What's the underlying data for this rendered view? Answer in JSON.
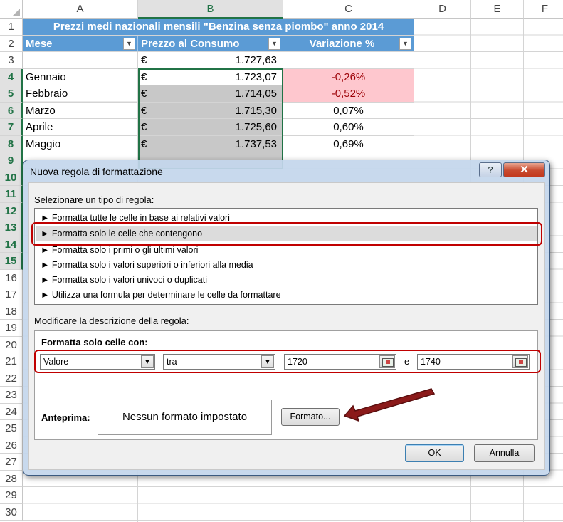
{
  "sheet": {
    "columns": [
      "A",
      "B",
      "C",
      "D",
      "E",
      "F"
    ],
    "rows": [
      "1",
      "2",
      "3",
      "4",
      "5",
      "6",
      "7",
      "8",
      "9",
      "10",
      "11",
      "12",
      "13",
      "14",
      "15",
      "16",
      "17",
      "18",
      "19",
      "20",
      "21",
      "22",
      "23",
      "24",
      "25",
      "26",
      "27",
      "28",
      "29",
      "30"
    ],
    "title": "Prezzi medi nazionali mensili \"Benzina senza piombo\" anno 2014",
    "headers": {
      "mese": "Mese",
      "prezzo": "Prezzo al Consumo",
      "variazione": "Variazione %"
    },
    "filter_glyph": "▼",
    "currency": "€",
    "data_rows": [
      {
        "mese": "",
        "prezzo": "1.727,63",
        "variazione": ""
      },
      {
        "mese": "Gennaio",
        "prezzo": "1.723,07",
        "variazione": "-0,26%"
      },
      {
        "mese": "Febbraio",
        "prezzo": "1.714,05",
        "variazione": "-0,52%"
      },
      {
        "mese": "Marzo",
        "prezzo": "1.715,30",
        "variazione": "0,07%"
      },
      {
        "mese": "Aprile",
        "prezzo": "1.725,60",
        "variazione": "0,60%"
      },
      {
        "mese": "Maggio",
        "prezzo": "1.737,53",
        "variazione": "0,69%"
      }
    ],
    "colors": {
      "header_blue": "#5b9bd5",
      "negative_fill": "#fec7ce",
      "negative_text": "#9c0006",
      "selected_fill": "#c8c8c8",
      "excel_green": "#217346"
    }
  },
  "dialog": {
    "title": "Nuova regola di formattazione",
    "help_label": "?",
    "close_label": "✕",
    "select_type_label": "Selezionare un tipo di regola:",
    "rule_types": [
      "► Formatta tutte le celle in base ai relativi valori",
      "► Formatta solo le celle che contengono",
      "► Formatta solo i primi o gli ultimi valori",
      "► Formatta solo i valori superiori o inferiori alla media",
      "► Formatta solo i valori univoci o duplicati",
      "► Utilizza una formula per determinare le celle da formattare"
    ],
    "edit_description_label": "Modificare la descrizione della regola:",
    "format_only_label": "Formatta solo celle con:",
    "condition": {
      "type_value": "Valore",
      "operator_value": "tra",
      "min_value": "1720",
      "and_label": "e",
      "max_value": "1740"
    },
    "preview_label": "Anteprima:",
    "preview_text": "Nessun formato impostato",
    "format_button": "Formato...",
    "ok_button": "OK",
    "cancel_button": "Annulla",
    "highlight_color": "#c00000"
  }
}
